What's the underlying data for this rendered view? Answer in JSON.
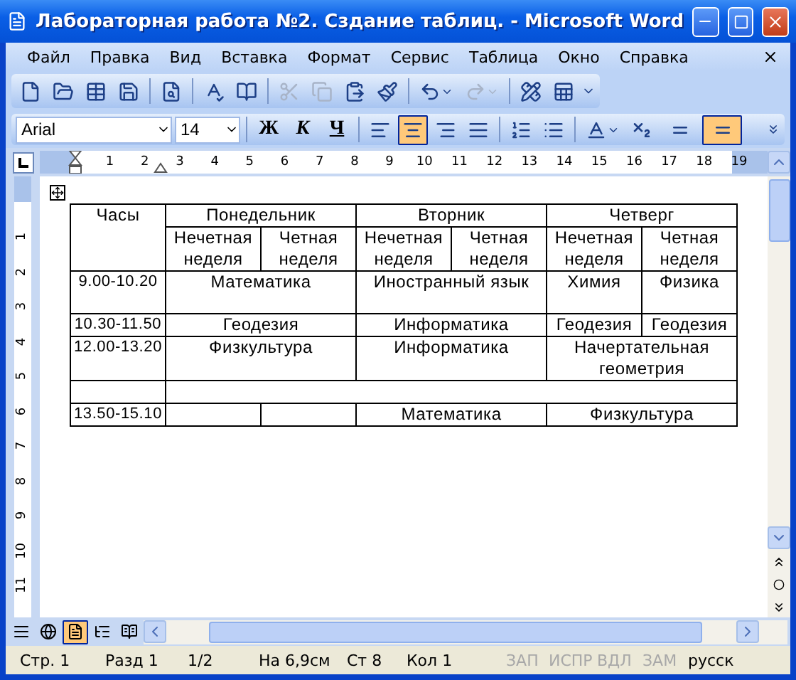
{
  "window": {
    "title": "Лабораторная работа №2. Сздание таблиц. - Microsoft Word"
  },
  "menu": [
    "Файл",
    "Правка",
    "Вид",
    "Вставка",
    "Формат",
    "Сервис",
    "Таблица",
    "Окно",
    "Справка"
  ],
  "standard_toolbar": [
    {
      "kind": "new",
      "disabled": false
    },
    {
      "kind": "open",
      "disabled": false
    },
    {
      "kind": "grid",
      "disabled": false
    },
    {
      "kind": "save",
      "disabled": false
    },
    {
      "kind": "sep"
    },
    {
      "kind": "preview",
      "disabled": false
    },
    {
      "kind": "sep"
    },
    {
      "kind": "spell",
      "disabled": false
    },
    {
      "kind": "research",
      "disabled": false
    },
    {
      "kind": "sep"
    },
    {
      "kind": "cut",
      "disabled": true
    },
    {
      "kind": "copy",
      "disabled": true
    },
    {
      "kind": "paste",
      "disabled": false
    },
    {
      "kind": "brush",
      "disabled": false
    },
    {
      "kind": "sep"
    },
    {
      "kind": "undo",
      "disabled": false
    },
    {
      "kind": "redo",
      "disabled": true
    },
    {
      "kind": "sep"
    },
    {
      "kind": "draw-table",
      "disabled": false
    },
    {
      "kind": "sheet",
      "disabled": false
    }
  ],
  "format_toolbar": {
    "font": "Arial",
    "size": "14",
    "styles": [
      {
        "label": "Ж",
        "kind": "bold"
      },
      {
        "label": "К",
        "kind": "italic"
      },
      {
        "label": "Ч",
        "kind": "underline"
      }
    ],
    "buttons": [
      {
        "kind": "sep"
      },
      {
        "kind": "align-left",
        "selected": false
      },
      {
        "kind": "align-center",
        "selected": true
      },
      {
        "kind": "align-right",
        "selected": false
      },
      {
        "kind": "align-justify",
        "selected": false
      },
      {
        "kind": "sep"
      },
      {
        "kind": "numbered-list",
        "selected": false
      },
      {
        "kind": "bullet-list",
        "selected": false
      },
      {
        "kind": "sep"
      },
      {
        "kind": "font-color",
        "selected": false
      },
      {
        "kind": "subscript",
        "selected": false
      },
      {
        "kind": "line",
        "selected": false
      },
      {
        "kind": "line",
        "selected": true
      }
    ]
  },
  "ruler": {
    "marks": [
      "1",
      "2",
      "3",
      "4",
      "5",
      "6",
      "7",
      "8",
      "9",
      "10",
      "11",
      "12",
      "13",
      "14",
      "15",
      "16",
      "17",
      "18",
      "19"
    ],
    "vertical_marks": [
      "1",
      "2",
      "3",
      "4",
      "5",
      "6",
      "7",
      "8",
      "9",
      "10",
      "11"
    ]
  },
  "table": {
    "time_header": "Часы",
    "days": [
      {
        "name": "Понедельник",
        "weeks": [
          "Нечетная неделя",
          "Четная неделя"
        ]
      },
      {
        "name": "Вторник",
        "weeks": [
          "Нечетная неделя",
          "Четная неделя"
        ]
      },
      {
        "name": "Четверг",
        "weeks": [
          "Нечетная неделя",
          "Четная неделя"
        ]
      }
    ],
    "rows": [
      [
        {
          "text": "9.00-10.20"
        },
        {
          "text": "Математика",
          "colspan": 2
        },
        {
          "text": "Иностранный язык",
          "colspan": 2
        },
        {
          "text": "Химия"
        },
        {
          "text": "Физика"
        }
      ],
      [
        {
          "text": "10.30-11.50"
        },
        {
          "text": "Геодезия",
          "colspan": 2
        },
        {
          "text": "Информатика",
          "colspan": 2
        },
        {
          "text": "Геодезия"
        },
        {
          "text": "Геодезия"
        }
      ],
      [
        {
          "text": "12.00-13.20"
        },
        {
          "text": "Физкультура",
          "colspan": 2
        },
        {
          "text": "Информатика",
          "colspan": 2
        },
        {
          "text": "Начертательная геометрия",
          "colspan": 2
        }
      ],
      [
        {
          "text": ""
        },
        {
          "text": "",
          "colspan": 6
        }
      ],
      [
        {
          "text": "13.50-15.10"
        },
        {
          "text": ""
        },
        {
          "text": ""
        },
        {
          "text": "Математика",
          "colspan": 2
        },
        {
          "text": "Физкультура",
          "colspan": 2
        }
      ]
    ]
  },
  "view_buttons": [
    {
      "kind": "normal",
      "selected": false
    },
    {
      "kind": "web",
      "selected": false
    },
    {
      "kind": "print",
      "selected": true
    },
    {
      "kind": "outline",
      "selected": false
    },
    {
      "kind": "reading",
      "selected": false
    }
  ],
  "status_bar": [
    {
      "text": "Стр. 1",
      "disabled": false
    },
    {
      "text": "Разд 1",
      "disabled": false
    },
    {
      "text": "1/2",
      "disabled": false
    },
    {
      "text": "На 6,9см",
      "disabled": false
    },
    {
      "text": "Ст 8",
      "disabled": false
    },
    {
      "text": "Кол 1",
      "disabled": false
    },
    {
      "text": "ЗАП",
      "disabled": true
    },
    {
      "text": "ИСПР",
      "disabled": true
    },
    {
      "text": "ВДЛ",
      "disabled": true
    },
    {
      "text": "ЗАМ",
      "disabled": true
    },
    {
      "text": "русск",
      "disabled": false
    }
  ]
}
